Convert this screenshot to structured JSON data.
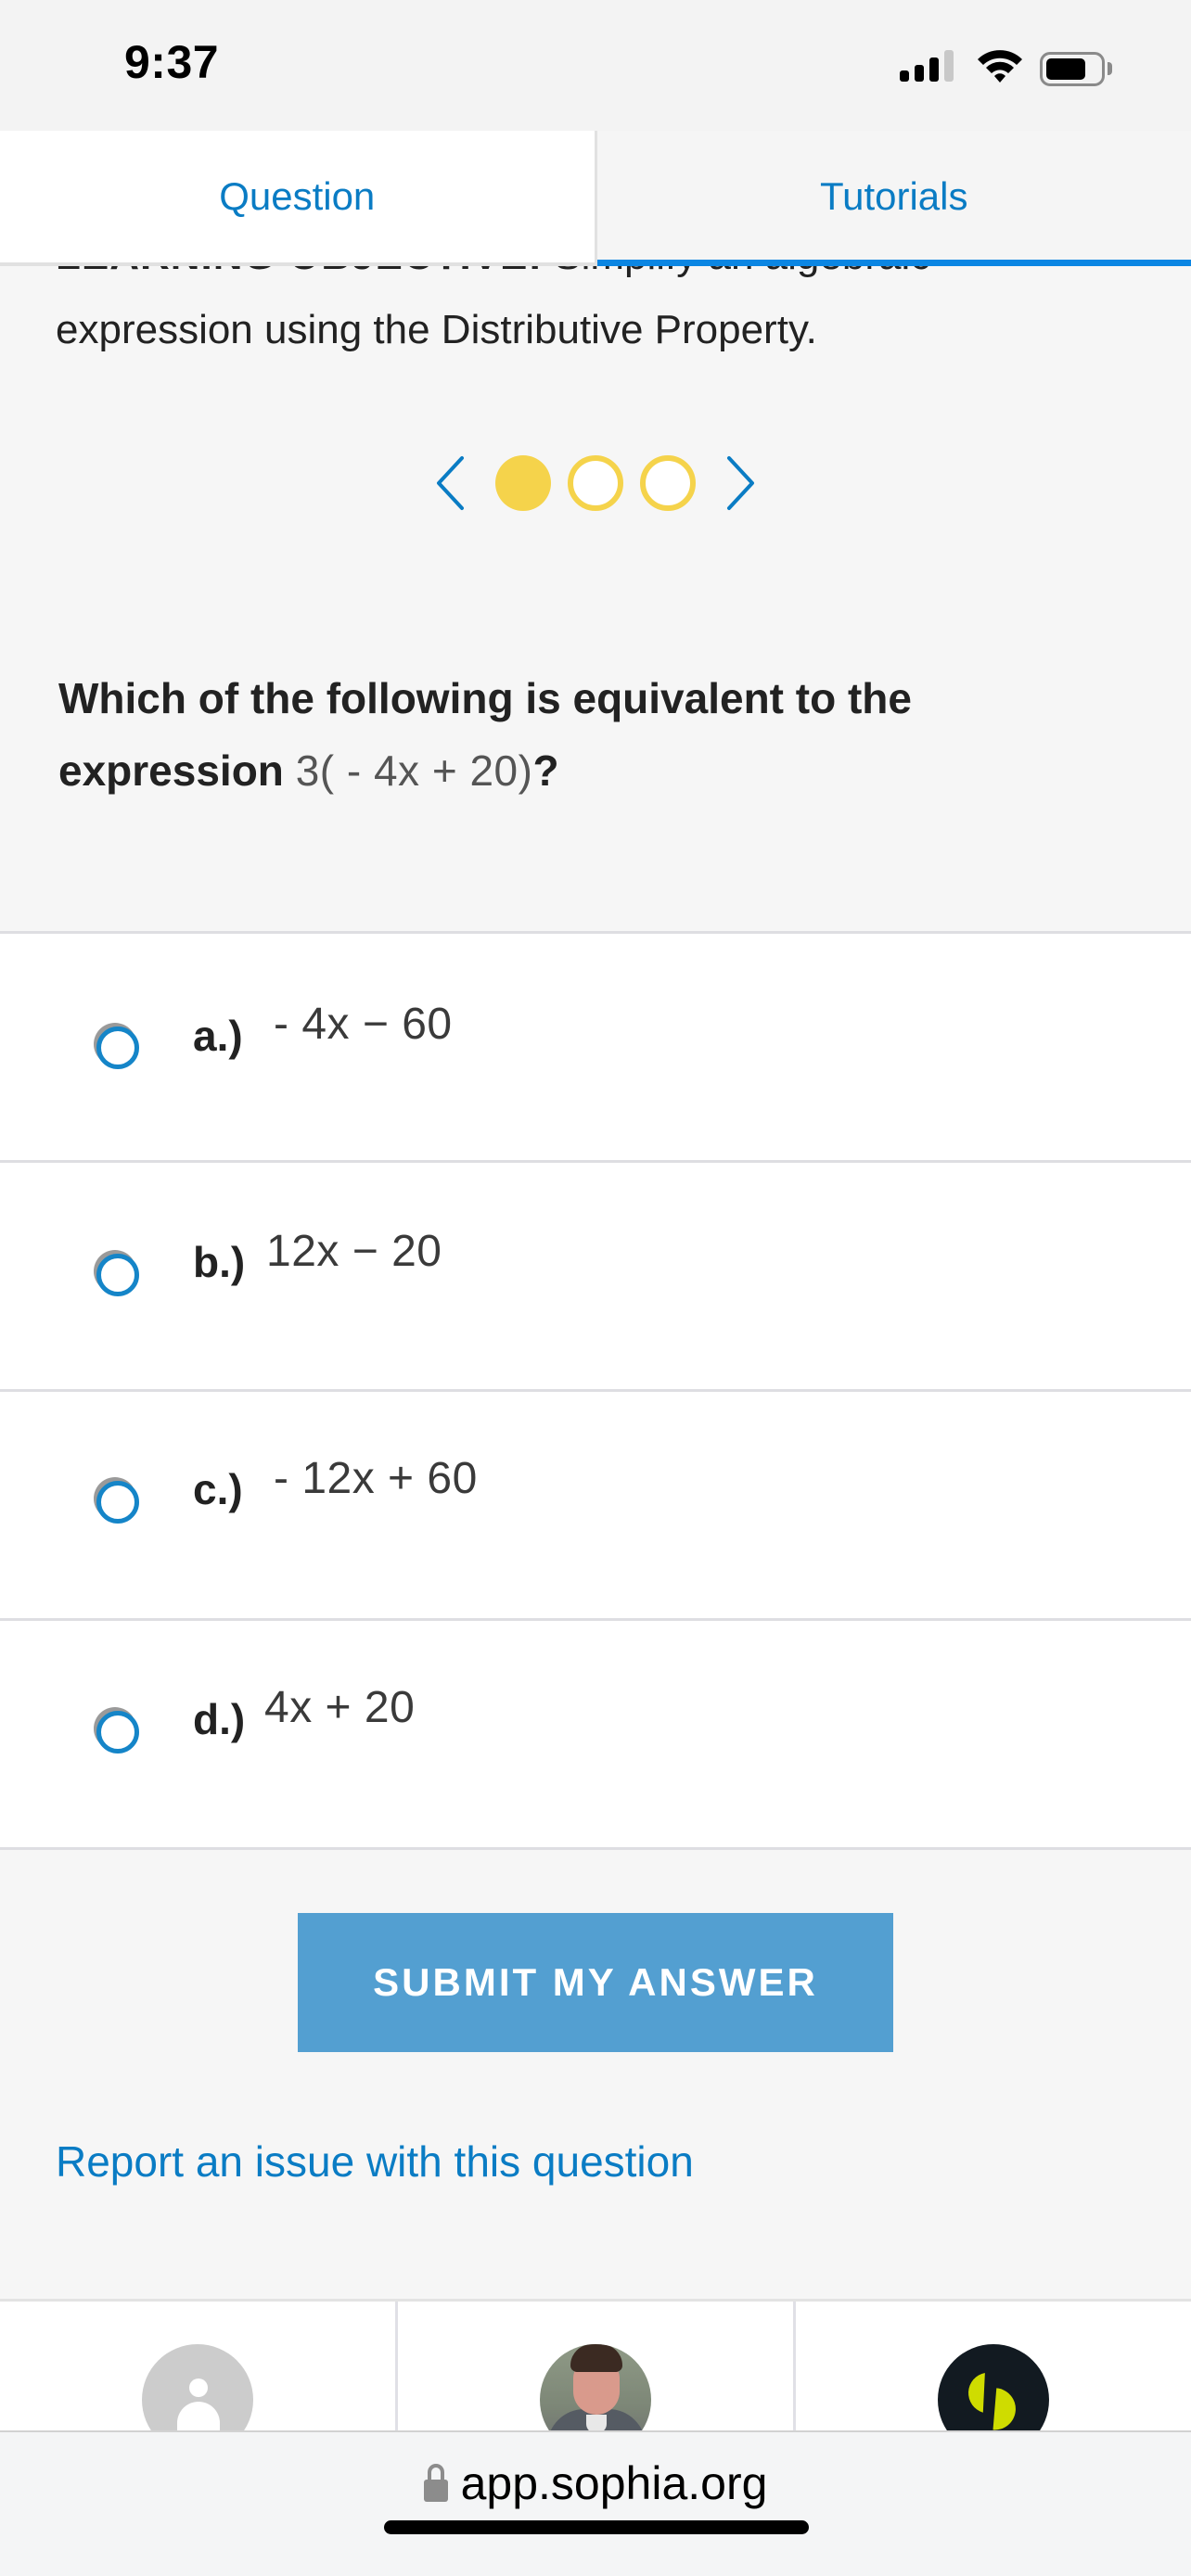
{
  "status_bar": {
    "time": "9:37",
    "signal_bars_filled": 3,
    "signal_bars_total": 4,
    "wifi": "wifi-icon",
    "battery_level": 0.75
  },
  "tabs": [
    {
      "label": "Question",
      "active": true
    },
    {
      "label": "Tutorials",
      "active": false,
      "underlined": true
    }
  ],
  "objective": {
    "label": "LEARNING OBJECTIVE:",
    "text": " Simplify an algebraic expression using the Distributive Property."
  },
  "pager": {
    "prev_icon": "chevron-left-icon",
    "next_icon": "chevron-right-icon",
    "current_index": 1,
    "total": 3
  },
  "question": {
    "prefix": "Which of the following is equivalent to the expression ",
    "expression": "3( - 4x  +  20)",
    "suffix": "?"
  },
  "options": [
    {
      "letter": "a.)",
      "value": "- 4x − 60"
    },
    {
      "letter": "b.)",
      "value": "12x − 20"
    },
    {
      "letter": "c.)",
      "value": "- 12x + 60"
    },
    {
      "letter": "d.)",
      "value": "4x + 20"
    }
  ],
  "submit_label": "SUBMIT MY ANSWER",
  "report_link": "Report an issue with this question",
  "bottom_nav": [
    {
      "name": "profile-default-avatar",
      "icon": "user-icon"
    },
    {
      "name": "tutor-photo-avatar",
      "icon": "photo-avatar"
    },
    {
      "name": "sophia-logo",
      "icon": "sophia-logo-icon"
    }
  ],
  "url_bar": {
    "url": "app.sophia.org",
    "secure": true
  },
  "colors": {
    "accent_blue": "#0a7cc4",
    "tab_underline": "#0b86e3",
    "submit_bg": "#539fd1",
    "pager_yellow": "#f5d34b",
    "radio_blue": "#1585c8",
    "sophia_dark": "#121a21",
    "sophia_lime": "#cfdc00"
  }
}
